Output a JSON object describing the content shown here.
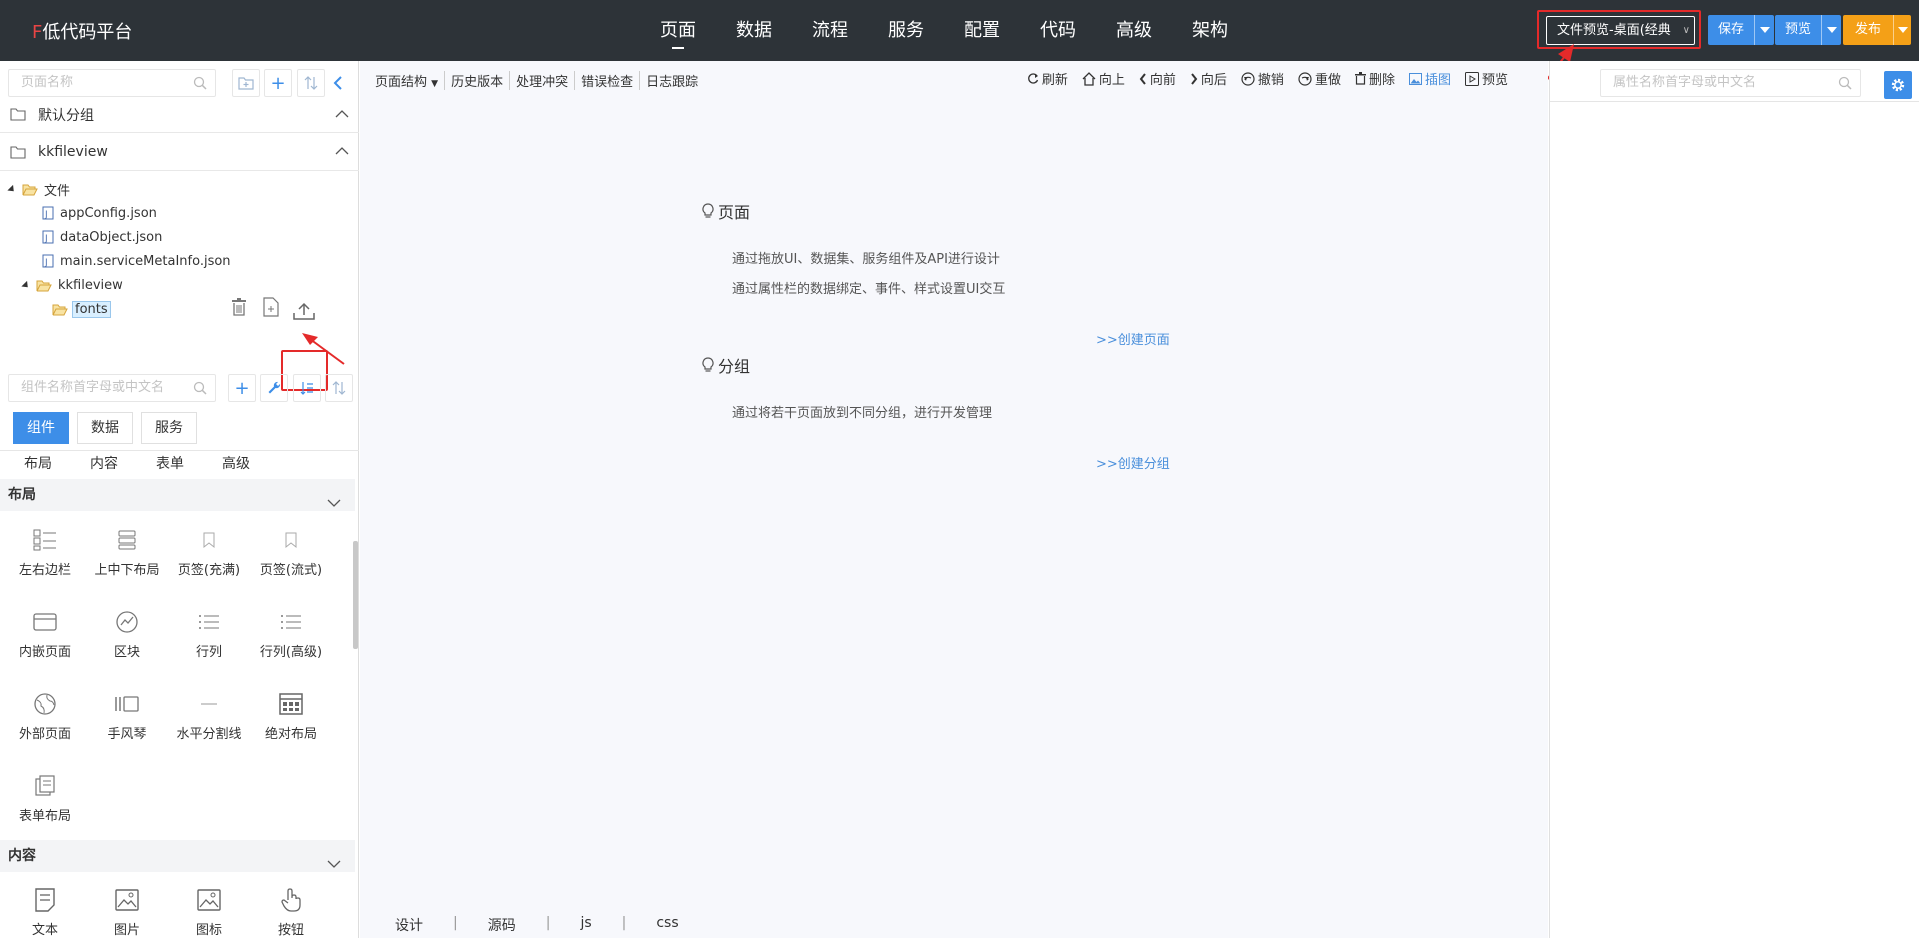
{
  "topbar": {
    "brand_mark": "F",
    "brand_text": "低代码平台",
    "nav": [
      "页面",
      "数据",
      "流程",
      "服务",
      "配置",
      "代码",
      "高级",
      "架构"
    ],
    "app_selector": "文件预览-桌面(经典",
    "save": "保存",
    "preview": "预览",
    "publish": "发布"
  },
  "left": {
    "page_search_placeholder": "页面名称",
    "groups": [
      "默认分组",
      "kkfileview"
    ],
    "tree": {
      "root": "文件",
      "files": [
        "appConfig.json",
        "dataObject.json",
        "main.serviceMetaInfo.json"
      ],
      "folder": "kkfileview",
      "selected": "fonts"
    },
    "component_search_placeholder": "组件名称首字母或中文名",
    "tabs": [
      "组件",
      "数据",
      "服务"
    ],
    "subtabs": [
      "布局",
      "内容",
      "表单",
      "高级"
    ],
    "layout_section": "布局",
    "layout_items": [
      "左右边栏",
      "上中下布局",
      "页签(充满)",
      "页签(流式)",
      "内嵌页面",
      "区块",
      "行列",
      "行列(高级)",
      "外部页面",
      "手风琴",
      "水平分割线",
      "绝对布局",
      "表单布局"
    ],
    "content_section": "内容",
    "content_items": [
      "文本",
      "图片",
      "图标",
      "按钮"
    ]
  },
  "center": {
    "toolbar_left": [
      "页面结构",
      "历史版本",
      "处理冲突",
      "错误检查",
      "日志跟踪"
    ],
    "toolbar_right": [
      "刷新",
      "向上",
      "向前",
      "向后",
      "撤销",
      "重做",
      "删除",
      "插图",
      "预览"
    ],
    "page_title": "页面",
    "page_line1": "通过拖放UI、数据集、服务组件及API进行设计",
    "page_line2": "通过属性栏的数据绑定、事件、样式设置UI交互",
    "create_page": ">>创建页面",
    "group_title": "分组",
    "group_line1": "通过将若干页面放到不同分组，进行开发管理",
    "create_group": ">>创建分组",
    "bottom_tabs": [
      "设计",
      "源码",
      "js",
      "css"
    ]
  },
  "right": {
    "search_placeholder": "属性名称首字母或中文名"
  },
  "colors": {
    "topbar_bg": "#2d3338",
    "accent_blue": "#3d8ee8",
    "accent_orange": "#f4a017",
    "highlight_red": "#e42a2a"
  }
}
